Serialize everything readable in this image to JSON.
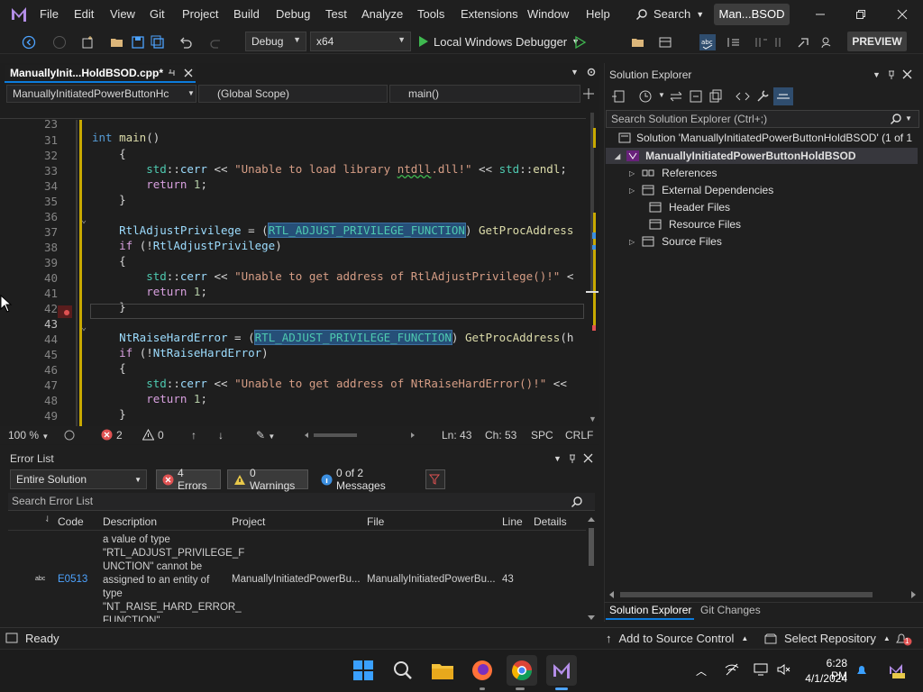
{
  "menubar": {
    "items": [
      "File",
      "Edit",
      "View",
      "Git",
      "Project",
      "Build",
      "Debug",
      "Test",
      "Analyze",
      "Tools",
      "Extensions",
      "Window",
      "Help"
    ],
    "search_label": "Search",
    "window_title": "Man...BSOD"
  },
  "toolbar": {
    "config": "Debug",
    "platform": "x64",
    "run_label": "Local Windows Debugger",
    "preview_label": "PREVIEW"
  },
  "editor": {
    "tab_label": "ManuallyInit...HoldBSOD.cpp*",
    "nav_project": "ManuallyInitiatedPowerButtonHc",
    "nav_scope": "(Global Scope)",
    "nav_member": "main()",
    "lines": [
      {
        "n": "23",
        "text": "int main()"
      },
      {
        "n": "31",
        "text": "    {"
      },
      {
        "n": "32",
        "text": "        std::cerr << \"Unable to load library ntdll.dll!\" << std::endl;"
      },
      {
        "n": "33",
        "text": "        return 1;"
      },
      {
        "n": "34",
        "text": "    }"
      },
      {
        "n": "35",
        "text": ""
      },
      {
        "n": "36",
        "text": "    RtlAdjustPrivilege = (RTL_ADJUST_PRIVILEGE_FUNCTION) GetProcAddress"
      },
      {
        "n": "37",
        "text": "    if (!RtlAdjustPrivilege)"
      },
      {
        "n": "38",
        "text": "    {"
      },
      {
        "n": "39",
        "text": "        std::cerr << \"Unable to get address of RtlAdjustPrivilege()!\" <"
      },
      {
        "n": "40",
        "text": "        return 1;"
      },
      {
        "n": "41",
        "text": "    }"
      },
      {
        "n": "42",
        "text": ""
      },
      {
        "n": "43",
        "text": "    NtRaiseHardError = (RTL_ADJUST_PRIVILEGE_FUNCTION) GetProcAddress(h"
      },
      {
        "n": "44",
        "text": "    if (!NtRaiseHardError)"
      },
      {
        "n": "45",
        "text": "    {"
      },
      {
        "n": "46",
        "text": "        std::cerr << \"Unable to get address of NtRaiseHardError()!\" <<"
      },
      {
        "n": "47",
        "text": "        return 1;"
      },
      {
        "n": "48",
        "text": "    }"
      },
      {
        "n": "49",
        "text": ""
      },
      {
        "n": "50",
        "text": ""
      }
    ],
    "status": {
      "zoom": "100 %",
      "errors": "2",
      "warnings": "0",
      "ln": "Ln: 43",
      "ch": "Ch: 53",
      "spc": "SPC",
      "crlf": "CRLF"
    }
  },
  "error_list": {
    "title": "Error List",
    "scope": "Entire Solution",
    "errors_btn": "4 Errors",
    "warnings_btn": "0 Warnings",
    "messages_btn": "0 of 2 Messages",
    "search_placeholder": "Search Error List",
    "columns": [
      "Code",
      "Description",
      "Project",
      "File",
      "Line",
      "Details"
    ],
    "row": {
      "code": "E0513",
      "description": "a value of type \"RTL_ADJUST_PRIVILEGE_F UNCTION\" cannot be assigned to an entity of type \"NT_RAISE_HARD_ERROR_ FUNCTION\"",
      "project": "ManuallyInitiatedPowerBu...",
      "file": "ManuallyInitiatedPowerBu...",
      "line": "43",
      "details": ""
    }
  },
  "solution_explorer": {
    "title": "Solution Explorer",
    "search_placeholder": "Search Solution Explorer (Ctrl+;)",
    "solution_label": "Solution 'ManuallyInitiatedPowerButtonHoldBSOD' (1 of 1",
    "project_label": "ManuallyInitiatedPowerButtonHoldBSOD",
    "items": [
      "References",
      "External Dependencies",
      "Header Files",
      "Resource Files",
      "Source Files"
    ],
    "tabs": [
      "Solution Explorer",
      "Git Changes"
    ]
  },
  "statusbar": {
    "ready": "Ready",
    "add_source": "Add to Source Control",
    "select_repo": "Select Repository",
    "notif_count": "1"
  },
  "taskbar": {
    "time": "6:28 PM",
    "date": "4/1/2024"
  },
  "colors": {
    "accent": "#0c7bdc",
    "error": "#e05252",
    "keyword": "#569cd6",
    "string": "#d69d85",
    "type": "#4ec9b0"
  }
}
